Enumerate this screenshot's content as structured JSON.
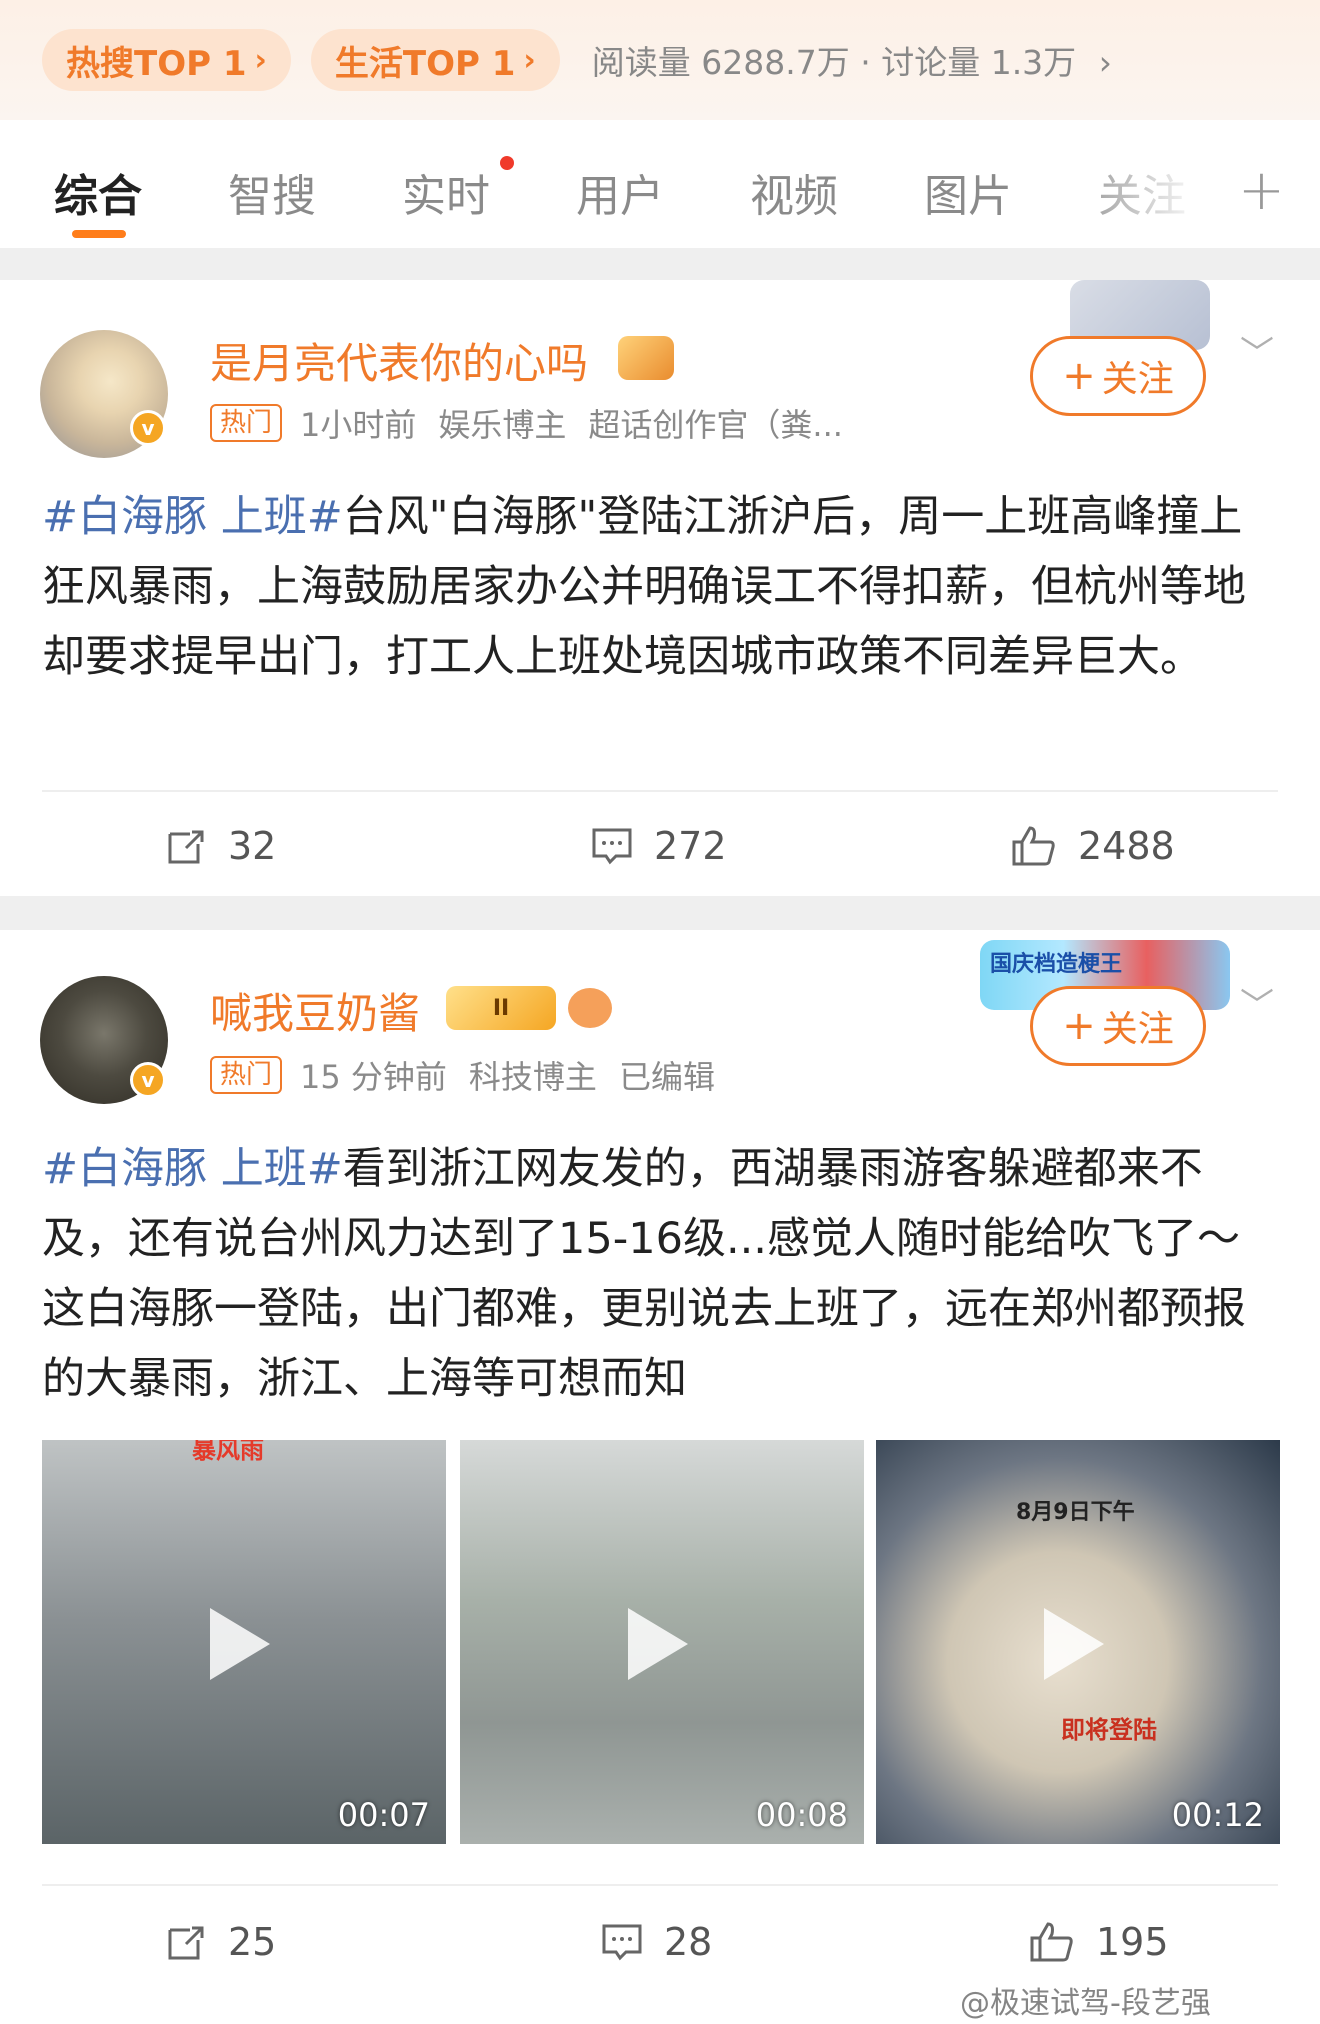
{
  "hot_search": {
    "pills": [
      {
        "label": "热搜TOP 1"
      },
      {
        "label": "生活TOP 1"
      }
    ],
    "stats": "阅读量 6288.7万 · 讨论量 1.3万"
  },
  "tabs": [
    "综合",
    "智搜",
    "实时",
    "用户",
    "视频",
    "图片",
    "关注"
  ],
  "active_tab": "综合",
  "posts": [
    {
      "username": "是月亮代表你的心吗",
      "hot_tag": "热门",
      "time": "1小时前",
      "meta": [
        "娱乐博主",
        "超话创作官（粪..."
      ],
      "follow_label": "关注",
      "hashtag": "#白海豚 上班#",
      "text": "台风\"白海豚\"登陆江浙沪后，周一上班高峰撞上狂风暴雨，上海鼓励居家办公并明确误工不得扣薪，但杭州等地却要求提早出门，打工人上班处境因城市政策不同差异巨大。",
      "actions": {
        "repost": "32",
        "comment": "272",
        "like": "2488"
      }
    },
    {
      "username": "喊我豆奶酱",
      "level_badge": "II",
      "hot_tag": "热门",
      "time": "15 分钟前",
      "meta": [
        "科技博主",
        "已编辑"
      ],
      "follow_label": "关注",
      "decoration_text": "国庆档造梗王",
      "hashtag": "#白海豚 上班#",
      "text": "看到浙江网友发的，西湖暴雨游客躲避都来不及，还有说台州风力达到了15-16级...感觉人随时能给吹飞了～这白海豚一登陆，出门都难，更别说去上班了，远在郑州都预报的大暴雨，浙江、上海等可想而知",
      "videos": [
        {
          "duration": "00:07",
          "tag": "暴风雨"
        },
        {
          "duration": "00:08"
        },
        {
          "duration": "00:12",
          "caption": "8月9日下午",
          "label": "即将登陆"
        }
      ],
      "actions": {
        "repost": "25",
        "comment": "28",
        "like": "195"
      }
    }
  ],
  "watermark": "@极速试驾-段艺强",
  "colors": {
    "accent": "#f07a2a",
    "hashtag": "#4a6fb0",
    "red_dot": "#f03a2a"
  }
}
